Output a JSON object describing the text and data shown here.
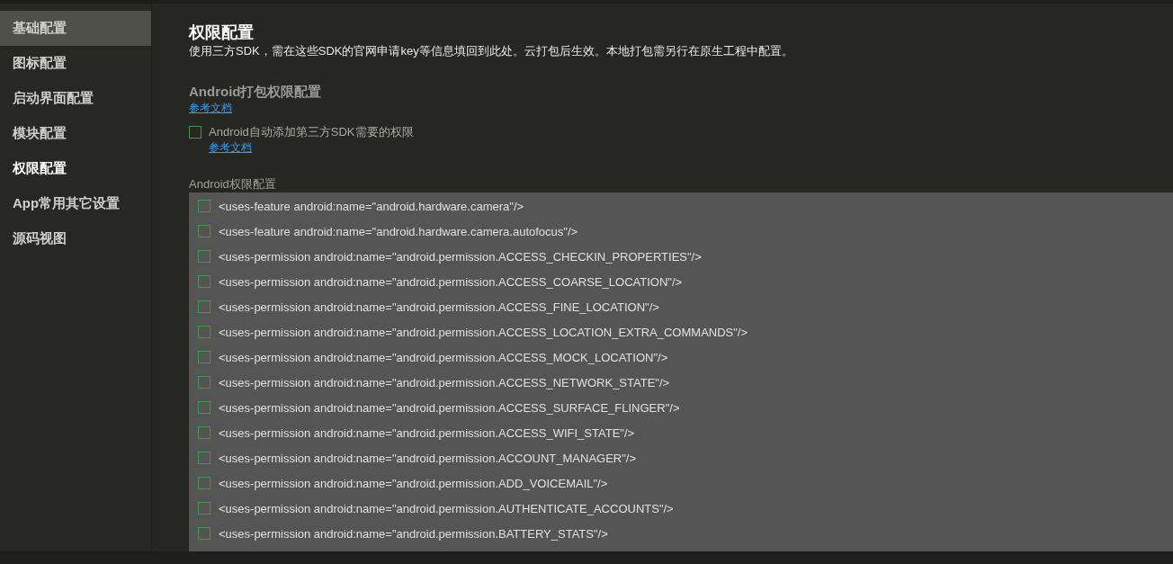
{
  "sidebar": {
    "items": [
      {
        "label": "基础配置",
        "selected": true,
        "current": false
      },
      {
        "label": "图标配置",
        "selected": false,
        "current": false
      },
      {
        "label": "启动界面配置",
        "selected": false,
        "current": false
      },
      {
        "label": "模块配置",
        "selected": false,
        "current": false
      },
      {
        "label": "权限配置",
        "selected": false,
        "current": true
      },
      {
        "label": "App常用其它设置",
        "selected": false,
        "current": false
      },
      {
        "label": "源码视图",
        "selected": false,
        "current": false
      }
    ]
  },
  "page": {
    "title": "权限配置",
    "description": "使用三方SDK，需在这些SDK的官网申请key等信息填回到此处。云打包后生效。本地打包需另行在原生工程中配置。"
  },
  "android_section": {
    "title": "Android打包权限配置",
    "doc_link": "参考文档",
    "auto_add": {
      "label": "Android自动添加第三方SDK需要的权限",
      "checked": false,
      "doc_link": "参考文档"
    }
  },
  "permissions": {
    "label": "Android权限配置",
    "items": [
      {
        "text": "<uses-feature android:name=\"android.hardware.camera\"/>",
        "checked": false
      },
      {
        "text": "<uses-feature android:name=\"android.hardware.camera.autofocus\"/>",
        "checked": false
      },
      {
        "text": "<uses-permission android:name=\"android.permission.ACCESS_CHECKIN_PROPERTIES\"/>",
        "checked": false
      },
      {
        "text": "<uses-permission android:name=\"android.permission.ACCESS_COARSE_LOCATION\"/>",
        "checked": false
      },
      {
        "text": "<uses-permission android:name=\"android.permission.ACCESS_FINE_LOCATION\"/>",
        "checked": false
      },
      {
        "text": "<uses-permission android:name=\"android.permission.ACCESS_LOCATION_EXTRA_COMMANDS\"/>",
        "checked": false
      },
      {
        "text": "<uses-permission android:name=\"android.permission.ACCESS_MOCK_LOCATION\"/>",
        "checked": false
      },
      {
        "text": "<uses-permission android:name=\"android.permission.ACCESS_NETWORK_STATE\"/>",
        "checked": false
      },
      {
        "text": "<uses-permission android:name=\"android.permission.ACCESS_SURFACE_FLINGER\"/>",
        "checked": false
      },
      {
        "text": "<uses-permission android:name=\"android.permission.ACCESS_WIFI_STATE\"/>",
        "checked": false
      },
      {
        "text": "<uses-permission android:name=\"android.permission.ACCOUNT_MANAGER\"/>",
        "checked": false
      },
      {
        "text": "<uses-permission android:name=\"android.permission.ADD_VOICEMAIL\"/>",
        "checked": false
      },
      {
        "text": "<uses-permission android:name=\"android.permission.AUTHENTICATE_ACCOUNTS\"/>",
        "checked": false
      },
      {
        "text": "<uses-permission android:name=\"android.permission.BATTERY_STATS\"/>",
        "checked": false
      }
    ]
  }
}
